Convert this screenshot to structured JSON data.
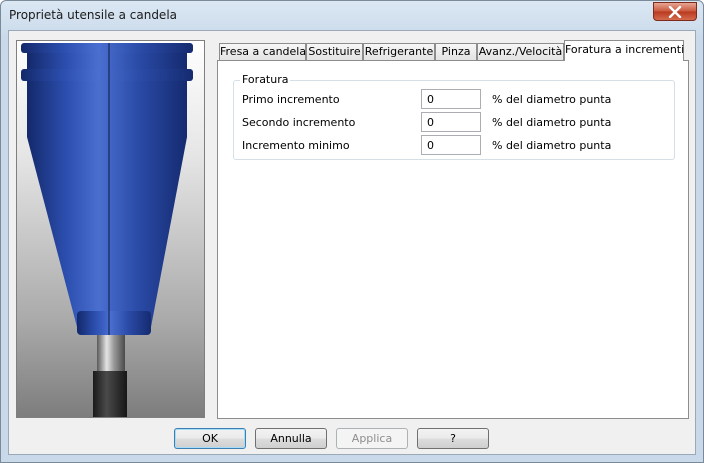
{
  "window": {
    "title": "Proprietà utensile a candela"
  },
  "tabs": [
    {
      "label": "Fresa a candela",
      "active": false
    },
    {
      "label": "Sostituire",
      "active": false
    },
    {
      "label": "Refrigerante",
      "active": false
    },
    {
      "label": "Pinza",
      "active": false
    },
    {
      "label": "Avanz./Velocità",
      "active": false
    },
    {
      "label": "Foratura a incrementi",
      "active": true
    }
  ],
  "group": {
    "title": "Foratura",
    "rows": [
      {
        "label": "Primo incremento",
        "value": "0",
        "unit": "% del diametro punta"
      },
      {
        "label": "Secondo incremento",
        "value": "0",
        "unit": "% del diametro punta"
      },
      {
        "label": "Incremento minimo",
        "value": "0",
        "unit": "% del diametro punta"
      }
    ]
  },
  "buttons": {
    "ok": "OK",
    "cancel": "Annulla",
    "apply": "Applica",
    "help": "?"
  },
  "colors": {
    "tool_body": "#1f3f96",
    "tool_highlight": "#4a6fd0",
    "shank": "#2e2e2e",
    "accent": "#3c7fb1"
  },
  "icons": {
    "close": "close-icon"
  }
}
